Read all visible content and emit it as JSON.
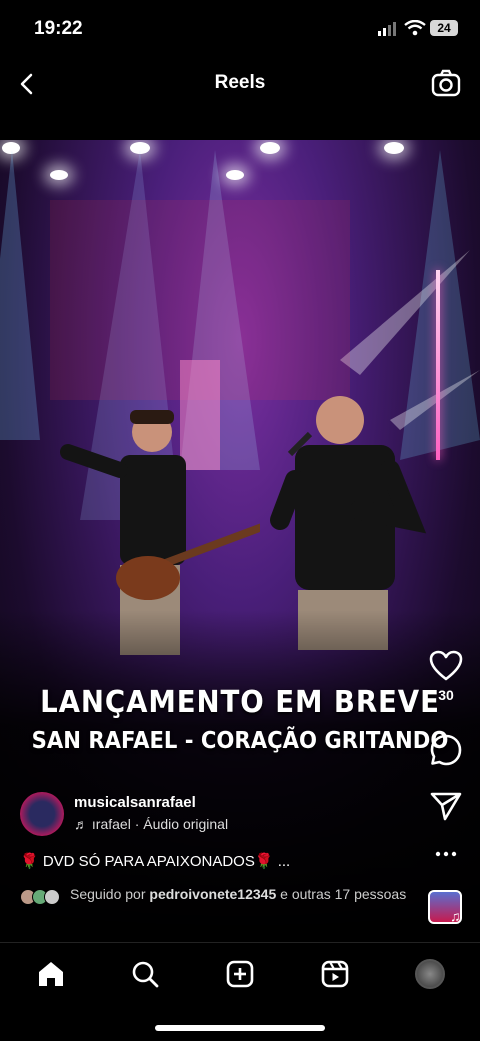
{
  "status": {
    "time": "19:22",
    "battery": "24"
  },
  "header": {
    "title": "Reels"
  },
  "video": {
    "caption_line1": "LANÇAMENTO EM BREVE",
    "caption_line2": "SAN RAFAEL - CORAÇÃO GRITANDO"
  },
  "actions": {
    "likes": "30"
  },
  "post": {
    "username": "musicalsanrafael",
    "audio": "ırafael · Áudio original",
    "description": "🌹 DVD SÓ PARA APAIXONADOS🌹 ...",
    "followed_prefix": "Seguido por ",
    "followed_user": "pedroivonete12345",
    "followed_suffix": " e outras 17 pessoas"
  },
  "icons": {
    "back": "chevron-left-icon",
    "camera": "camera-icon",
    "like": "heart-icon",
    "comment": "comment-icon",
    "share": "send-icon",
    "more": "more-icon",
    "home": "home-icon",
    "search": "search-icon",
    "create": "plus-square-icon",
    "reels": "reels-icon",
    "profile": "avatar"
  }
}
